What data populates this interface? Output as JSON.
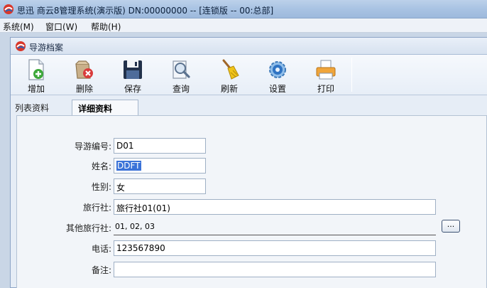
{
  "window": {
    "title": "思迅 商云8管理系统(演示版) DN:00000000 -- [连锁版 -- 00:总部]"
  },
  "menu": [
    {
      "label": "系统(M)"
    },
    {
      "label": "窗口(W)"
    },
    {
      "label": "帮助(H)"
    }
  ],
  "child_window": {
    "title": "导游档案"
  },
  "toolbar": {
    "buttons": [
      {
        "label": "增加",
        "icon": "add-document-icon"
      },
      {
        "label": "删除",
        "icon": "delete-icon"
      },
      {
        "label": "保存",
        "icon": "save-icon"
      },
      {
        "label": "查询",
        "icon": "search-icon"
      },
      {
        "label": "刷新",
        "icon": "refresh-broom-icon"
      },
      {
        "label": "设置",
        "icon": "settings-gear-icon"
      },
      {
        "label": "打印",
        "icon": "printer-icon"
      }
    ]
  },
  "tabs": [
    {
      "label": "列表资料",
      "active": false
    },
    {
      "label": "详细资料",
      "active": true
    }
  ],
  "form": {
    "guide_no": {
      "label": "导游编号:",
      "value": "D01"
    },
    "name": {
      "label": "姓名:",
      "value": "DDFT"
    },
    "gender": {
      "label": "性别:",
      "value": "女"
    },
    "agency": {
      "label": "旅行社:",
      "value": "旅行社01(01)"
    },
    "other_agencies": {
      "label": "其他旅行社:",
      "value": "01, 02, 03",
      "button": "..."
    },
    "phone": {
      "label": "电话:",
      "value": "123567890"
    },
    "remark": {
      "label": "备注:",
      "value": ""
    }
  },
  "colors": {
    "accent": "#3a72d8",
    "titlebar": "#a9c3e3"
  }
}
